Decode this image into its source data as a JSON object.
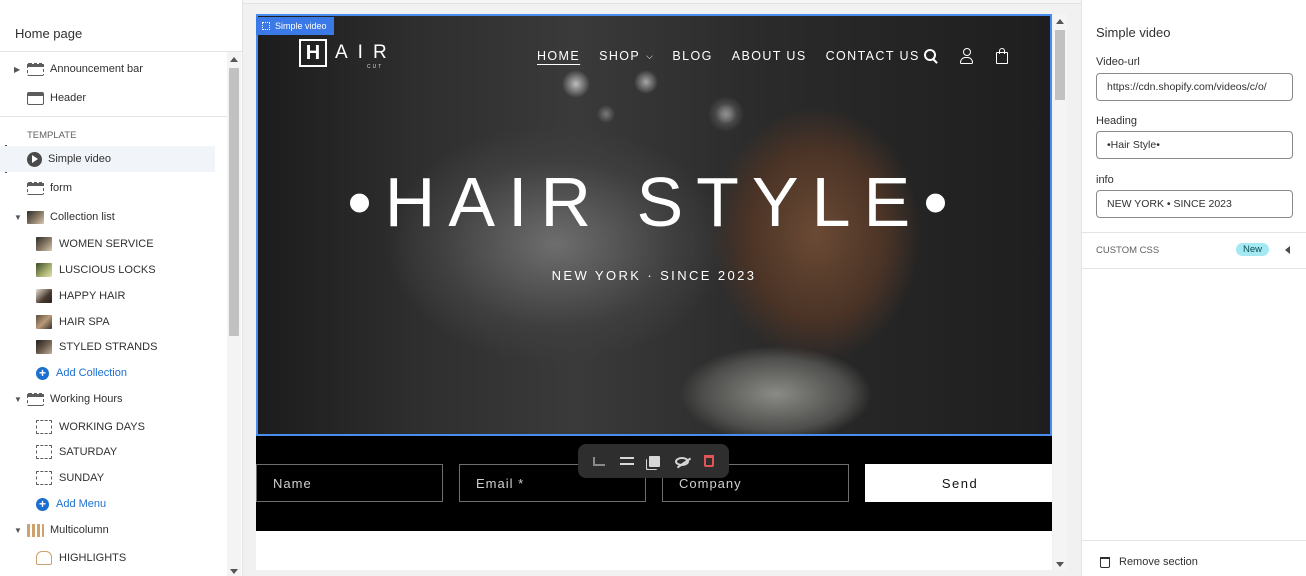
{
  "sidebar": {
    "title": "Home page",
    "template_label": "TEMPLATE",
    "items": [
      {
        "label": "Announcement bar"
      },
      {
        "label": "Header"
      },
      {
        "label": "Simple video"
      },
      {
        "label": "form"
      },
      {
        "label": "Collection list"
      },
      {
        "label": "WOMEN SERVICE"
      },
      {
        "label": "LUSCIOUS LOCKS"
      },
      {
        "label": "HAPPY HAIR"
      },
      {
        "label": "HAIR SPA"
      },
      {
        "label": "STYLED STRANDS"
      },
      {
        "label": "Add Collection"
      },
      {
        "label": "Working Hours"
      },
      {
        "label": "WORKING DAYS"
      },
      {
        "label": "SATURDAY"
      },
      {
        "label": "SUNDAY"
      },
      {
        "label": "Add Menu"
      },
      {
        "label": "Multicolumn"
      },
      {
        "label": "HIGHLIGHTS"
      }
    ]
  },
  "preview": {
    "section_tag": "Simple video",
    "logo_letter": "H",
    "logo_rest": "AIR",
    "logo_sub": "CUT",
    "nav": [
      "HOME",
      "SHOP",
      "BLOG",
      "ABOUT US",
      "CONTACT US"
    ],
    "heading": "•HAIR STYLE•",
    "info": "NEW YORK · SINCE 2023",
    "form": {
      "name_placeholder": "Name",
      "email_placeholder": "Email *",
      "company_placeholder": "Company",
      "send_label": "Send"
    }
  },
  "settings": {
    "title": "Simple video",
    "video_url_label": "Video-url",
    "video_url_value": "https://cdn.shopify.com/videos/c/o/",
    "heading_label": "Heading",
    "heading_value": "•Hair Style•",
    "info_label": "info",
    "info_value": "NEW YORK • SINCE 2023",
    "custom_css_label": "CUSTOM CSS",
    "new_badge": "New",
    "remove_label": "Remove section"
  },
  "colors": {
    "accent": "#3b7ae6",
    "link": "#1b6fcf",
    "badge_bg": "#a4e8f2",
    "delete": "#e05656"
  }
}
